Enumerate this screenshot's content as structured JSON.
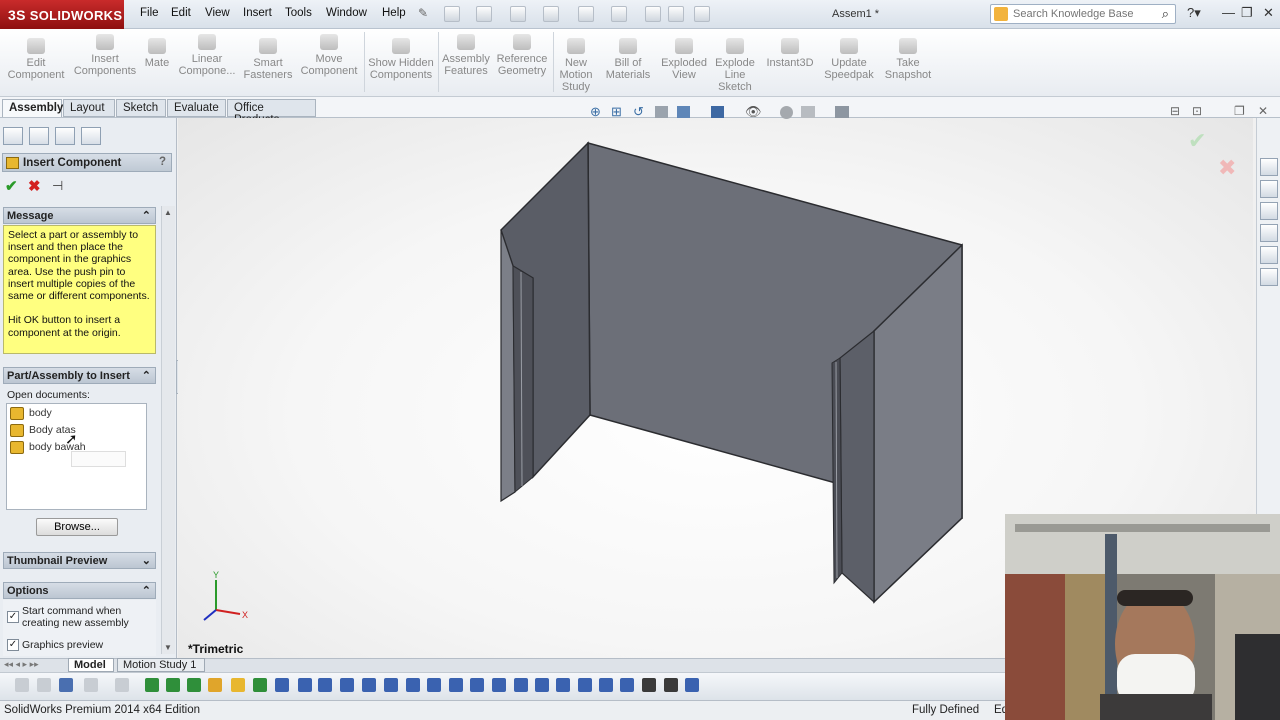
{
  "app": {
    "brand": "SOLIDWORKS",
    "brand_prefix": "3S",
    "document_title": "Assem1 *"
  },
  "menu": [
    "File",
    "Edit",
    "View",
    "Insert",
    "Tools",
    "Window",
    "Help"
  ],
  "search": {
    "placeholder": "Search Knowledge Base"
  },
  "command_manager": [
    {
      "label": "Edit Component"
    },
    {
      "label": "Insert Components"
    },
    {
      "label": "Mate"
    },
    {
      "label": "Linear Compone..."
    },
    {
      "label": "Smart Fasteners"
    },
    {
      "label": "Move Component"
    },
    {
      "label": "Show Hidden Components"
    },
    {
      "label": "Assembly Features"
    },
    {
      "label": "Reference Geometry"
    },
    {
      "label": "New Motion Study"
    },
    {
      "label": "Bill of Materials"
    },
    {
      "label": "Exploded View"
    },
    {
      "label": "Explode Line Sketch"
    },
    {
      "label": "Instant3D"
    },
    {
      "label": "Update Speedpak"
    },
    {
      "label": "Take Snapshot"
    }
  ],
  "tabs": [
    "Assembly",
    "Layout",
    "Sketch",
    "Evaluate",
    "Office Products"
  ],
  "property_manager": {
    "title": "Insert Component",
    "help": "?",
    "message_header": "Message",
    "message": "Select a part or assembly to insert and then place the component in the graphics area. Use the push pin to insert multiple copies of the same or different components.\n\nHit OK button to insert a component at the origin.",
    "part_header": "Part/Assembly to Insert",
    "open_documents_label": "Open documents:",
    "open_documents": [
      "body",
      "Body atas",
      "body bawah"
    ],
    "browse_label": "Browse...",
    "thumbnail_header": "Thumbnail Preview",
    "options_header": "Options",
    "options": [
      {
        "label": "Start command when creating new assembly",
        "checked": true
      },
      {
        "label": "Graphics preview",
        "checked": true
      }
    ]
  },
  "graphics": {
    "view_orientation": "*Trimetric"
  },
  "bottom_tabs": [
    "Model",
    "Motion Study 1"
  ],
  "status": {
    "edition": "SolidWorks Premium 2014 x64 Edition",
    "state": "Fully Defined",
    "state_truncated": "Ed"
  },
  "colors": {
    "brand_red": "#b01c1c",
    "message_yellow": "#ffff80",
    "part_gray": "#6c6f78"
  }
}
